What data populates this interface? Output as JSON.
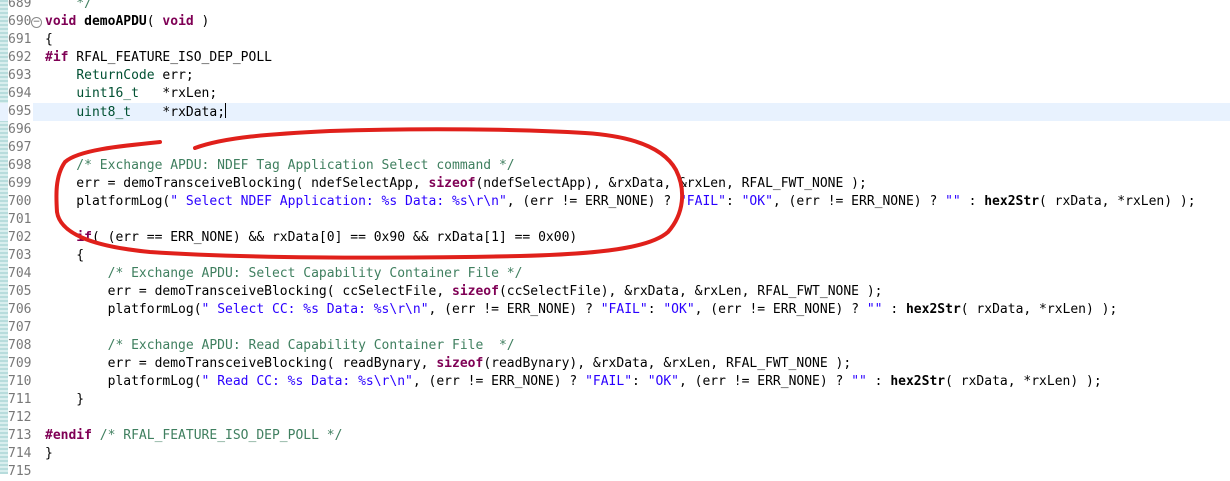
{
  "editor": {
    "lines": [
      {
        "num": "689",
        "tokens": [
          {
            "t": "    */",
            "c": "cmt"
          }
        ]
      },
      {
        "num": "690",
        "fold": "−",
        "tokens": [
          {
            "t": "void ",
            "c": "kw"
          },
          {
            "t": "demoAPDU",
            "c": "fn-bold"
          },
          {
            "t": "( ",
            "c": ""
          },
          {
            "t": "void",
            "c": "kw"
          },
          {
            "t": " )",
            "c": ""
          }
        ]
      },
      {
        "num": "691",
        "tokens": [
          {
            "t": "{",
            "c": ""
          }
        ]
      },
      {
        "num": "692",
        "tokens": [
          {
            "t": "#if",
            "c": "pp"
          },
          {
            "t": " RFAL_FEATURE_ISO_DEP_POLL",
            "c": ""
          }
        ]
      },
      {
        "num": "693",
        "tokens": [
          {
            "t": "    ",
            "c": ""
          },
          {
            "t": "ReturnCode",
            "c": "ty"
          },
          {
            "t": " err;",
            "c": ""
          }
        ]
      },
      {
        "num": "694",
        "tokens": [
          {
            "t": "    ",
            "c": ""
          },
          {
            "t": "uint16_t",
            "c": "ty"
          },
          {
            "t": "   *rxLen;",
            "c": ""
          }
        ]
      },
      {
        "num": "695",
        "current": true,
        "caret": true,
        "tokens": [
          {
            "t": "    ",
            "c": ""
          },
          {
            "t": "uint8_t",
            "c": "ty"
          },
          {
            "t": "    *rxData;",
            "c": ""
          }
        ]
      },
      {
        "num": "696",
        "tokens": []
      },
      {
        "num": "697",
        "tokens": []
      },
      {
        "num": "698",
        "tokens": [
          {
            "t": "    /* Exchange APDU: NDEF Tag Application Select command */",
            "c": "cmt"
          }
        ]
      },
      {
        "num": "699",
        "tokens": [
          {
            "t": "    err = demoTransceiveBlocking( ndefSelectApp, ",
            "c": ""
          },
          {
            "t": "sizeof",
            "c": "kw"
          },
          {
            "t": "(ndefSelectApp), &rxData, &rxLen, RFAL_FWT_NONE );",
            "c": ""
          }
        ]
      },
      {
        "num": "700",
        "tokens": [
          {
            "t": "    platformLog(",
            "c": ""
          },
          {
            "t": "\" Select NDEF Application: %s Data: %s\\r\\n\"",
            "c": "str"
          },
          {
            "t": ", (err != ERR_NONE) ? ",
            "c": ""
          },
          {
            "t": "\"FAIL\"",
            "c": "str"
          },
          {
            "t": ": ",
            "c": ""
          },
          {
            "t": "\"OK\"",
            "c": "str"
          },
          {
            "t": ", (err != ERR_NONE) ? ",
            "c": ""
          },
          {
            "t": "\"\"",
            "c": "str"
          },
          {
            "t": " : ",
            "c": ""
          },
          {
            "t": "hex2Str",
            "c": "fn-bold"
          },
          {
            "t": "( rxData, *rxLen) );",
            "c": ""
          }
        ]
      },
      {
        "num": "701",
        "tokens": []
      },
      {
        "num": "702",
        "tokens": [
          {
            "t": "    ",
            "c": ""
          },
          {
            "t": "if",
            "c": "kw"
          },
          {
            "t": "( (err == ERR_NONE) && rxData[0] == 0x90 && rxData[1] == 0x00)",
            "c": ""
          }
        ]
      },
      {
        "num": "703",
        "tokens": [
          {
            "t": "    {",
            "c": ""
          }
        ]
      },
      {
        "num": "704",
        "tokens": [
          {
            "t": "        /* Exchange APDU: Select Capability Container File */",
            "c": "cmt"
          }
        ]
      },
      {
        "num": "705",
        "tokens": [
          {
            "t": "        err = demoTransceiveBlocking( ccSelectFile, ",
            "c": ""
          },
          {
            "t": "sizeof",
            "c": "kw"
          },
          {
            "t": "(ccSelectFile), &rxData, &rxLen, RFAL_FWT_NONE );",
            "c": ""
          }
        ]
      },
      {
        "num": "706",
        "tokens": [
          {
            "t": "        platformLog(",
            "c": ""
          },
          {
            "t": "\" Select CC: %s Data: %s\\r\\n\"",
            "c": "str"
          },
          {
            "t": ", (err != ERR_NONE) ? ",
            "c": ""
          },
          {
            "t": "\"FAIL\"",
            "c": "str"
          },
          {
            "t": ": ",
            "c": ""
          },
          {
            "t": "\"OK\"",
            "c": "str"
          },
          {
            "t": ", (err != ERR_NONE) ? ",
            "c": ""
          },
          {
            "t": "\"\"",
            "c": "str"
          },
          {
            "t": " : ",
            "c": ""
          },
          {
            "t": "hex2Str",
            "c": "fn-bold"
          },
          {
            "t": "( rxData, *rxLen) );",
            "c": ""
          }
        ]
      },
      {
        "num": "707",
        "tokens": []
      },
      {
        "num": "708",
        "tokens": [
          {
            "t": "        /* Exchange APDU: Read Capability Container File  */",
            "c": "cmt"
          }
        ]
      },
      {
        "num": "709",
        "tokens": [
          {
            "t": "        err = demoTransceiveBlocking( readBynary, ",
            "c": ""
          },
          {
            "t": "sizeof",
            "c": "kw"
          },
          {
            "t": "(readBynary), &rxData, &rxLen, RFAL_FWT_NONE );",
            "c": ""
          }
        ]
      },
      {
        "num": "710",
        "tokens": [
          {
            "t": "        platformLog(",
            "c": ""
          },
          {
            "t": "\" Read CC: %s Data: %s\\r\\n\"",
            "c": "str"
          },
          {
            "t": ", (err != ERR_NONE) ? ",
            "c": ""
          },
          {
            "t": "\"FAIL\"",
            "c": "str"
          },
          {
            "t": ": ",
            "c": ""
          },
          {
            "t": "\"OK\"",
            "c": "str"
          },
          {
            "t": ", (err != ERR_NONE) ? ",
            "c": ""
          },
          {
            "t": "\"\"",
            "c": "str"
          },
          {
            "t": " : ",
            "c": ""
          },
          {
            "t": "hex2Str",
            "c": "fn-bold"
          },
          {
            "t": "( rxData, *rxLen) );",
            "c": ""
          }
        ]
      },
      {
        "num": "711",
        "tokens": [
          {
            "t": "    }",
            "c": ""
          }
        ]
      },
      {
        "num": "712",
        "tokens": []
      },
      {
        "num": "713",
        "tokens": [
          {
            "t": "#endif",
            "c": "pp"
          },
          {
            "t": " /* RFAL_FEATURE_ISO_DEP_POLL */",
            "c": "cmt"
          }
        ]
      },
      {
        "num": "714",
        "tokens": [
          {
            "t": "}",
            "c": ""
          }
        ]
      },
      {
        "num": "715",
        "tokens": []
      }
    ]
  },
  "colors": {
    "keyword": "#7f0055",
    "type": "#005032",
    "string": "#2a00ff",
    "comment": "#3f7f5f",
    "line_number": "#787878",
    "current_line": "#e8f2fe",
    "annotation": "#e0201b"
  }
}
